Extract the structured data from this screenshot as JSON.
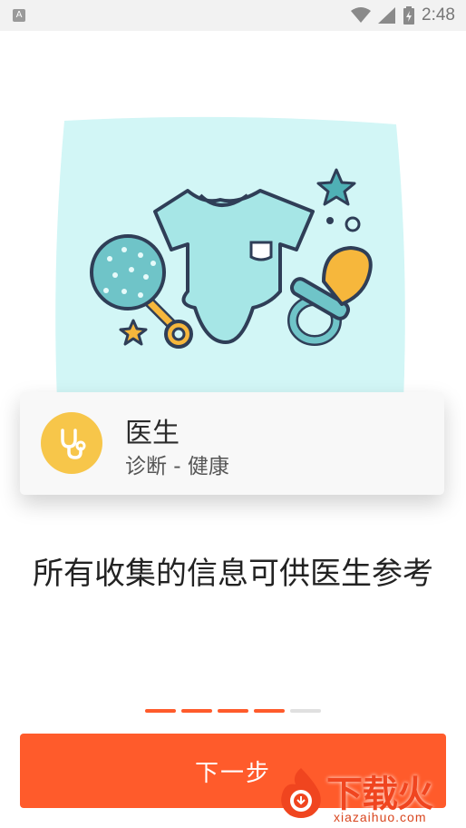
{
  "status_bar": {
    "notification_icon_label": "A",
    "time": "2:48"
  },
  "card": {
    "title": "医生",
    "subtitle": "诊断 - 健康"
  },
  "description": "所有收集的信息可供医生参考",
  "pager": {
    "total": 5,
    "active_count": 4,
    "active_color": "#ff5b2b",
    "inactive_color": "#e0e0e0"
  },
  "next_button": {
    "label": "下一步"
  },
  "watermark": {
    "brand": "下载火",
    "url": "xiazaihuo.com"
  },
  "colors": {
    "accent": "#ff5b2b",
    "illustration_bg": "#d2f6f6",
    "icon_circle": "#f7c64a"
  }
}
